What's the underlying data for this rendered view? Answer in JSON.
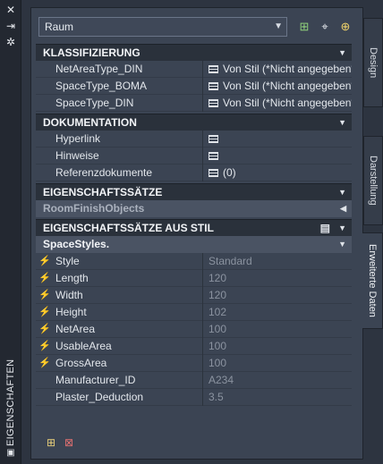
{
  "titlebar": {
    "title": "EIGENSCHAFTEN"
  },
  "toolbar": {
    "combo_value": "Raum"
  },
  "sections": {
    "klassifizierung": {
      "title": "KLASSIFIZIERUNG",
      "rows": [
        {
          "name": "NetAreaType_DIN",
          "value": "Von Stil (*Nicht angegeben*)"
        },
        {
          "name": "SpaceType_BOMA",
          "value": "Von Stil (*Nicht angegeben*)"
        },
        {
          "name": "SpaceType_DIN",
          "value": "Von Stil (*Nicht angegeben*)"
        }
      ]
    },
    "dokumentation": {
      "title": "DOKUMENTATION",
      "rows": [
        {
          "name": "Hyperlink",
          "value": ""
        },
        {
          "name": "Hinweise",
          "value": ""
        },
        {
          "name": "Referenzdokumente",
          "value": "(0)"
        }
      ]
    },
    "eigenschaftssaetze": {
      "title": "EIGENSCHAFTSSÄTZE",
      "sub": "RoomFinishObjects"
    },
    "ausstil": {
      "title": "EIGENSCHAFTSSÄTZE AUS STIL",
      "sub": "SpaceStyles.",
      "rows": [
        {
          "name": "Style",
          "value": "Standard"
        },
        {
          "name": "Length",
          "value": "120"
        },
        {
          "name": "Width",
          "value": "120"
        },
        {
          "name": "Height",
          "value": "102"
        },
        {
          "name": "NetArea",
          "value": "100"
        },
        {
          "name": "UsableArea",
          "value": "100"
        },
        {
          "name": "GrossArea",
          "value": "100"
        },
        {
          "name": "Manufacturer_ID",
          "value": "A234"
        },
        {
          "name": "Plaster_Deduction",
          "value": "3.5"
        }
      ]
    }
  },
  "tabs": [
    "Design",
    "Darstellung",
    "Erweiterte Daten"
  ]
}
